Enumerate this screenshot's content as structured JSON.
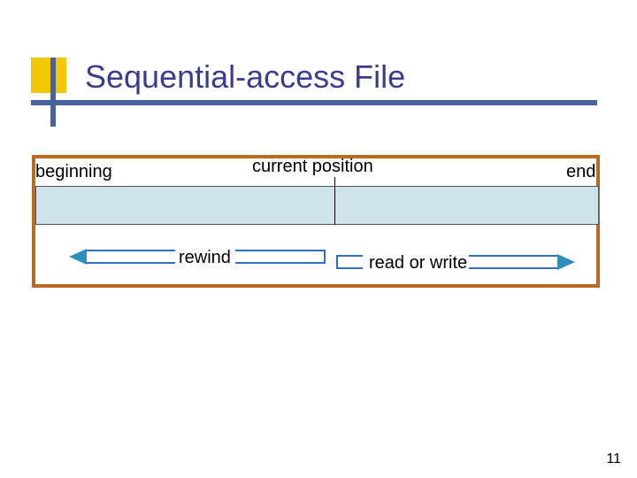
{
  "title": "Sequential-access File",
  "labels": {
    "beginning": "beginning",
    "current_position": "current position",
    "end": "end",
    "rewind": "rewind",
    "read_or_write": "read or write"
  },
  "page_number": "11"
}
